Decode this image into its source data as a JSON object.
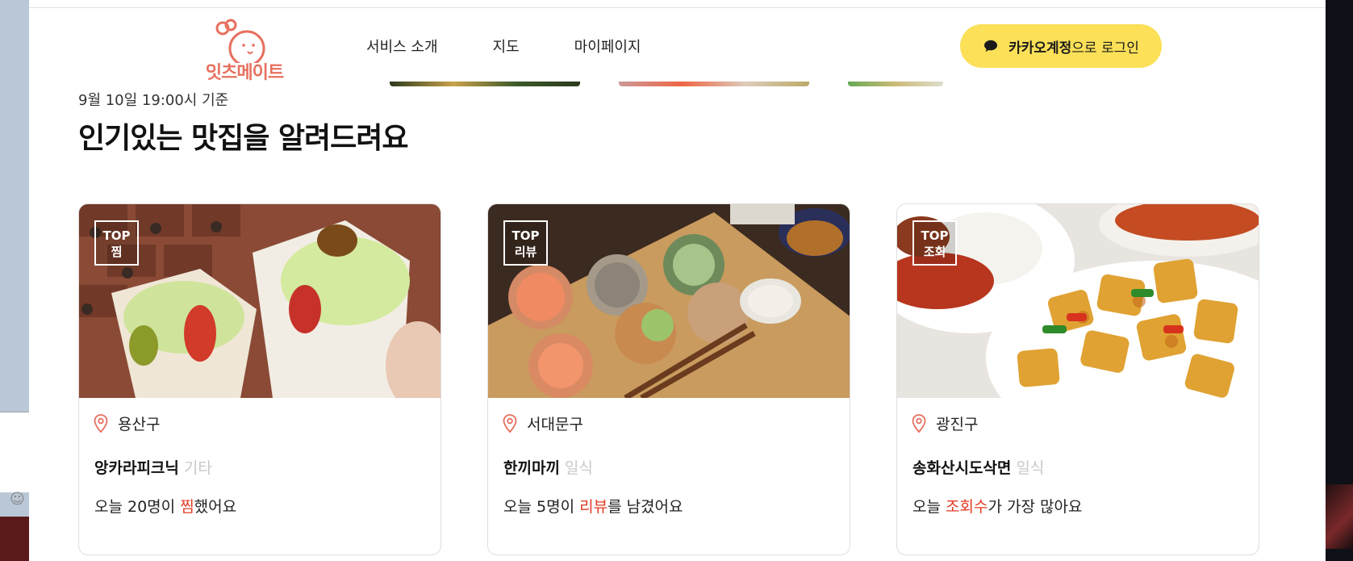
{
  "logo": {
    "text": "잇츠메이트",
    "icon": "chef-face-logo-icon"
  },
  "nav": {
    "items": [
      "서비스 소개",
      "지도",
      "마이페이지"
    ]
  },
  "login": {
    "strong": "카카오계정",
    "rest": "으로 로그인",
    "icon": "kakao-talk-bubble-icon"
  },
  "section": {
    "timestamp": "9월 10일 19:00시 기준",
    "title": "인기있는 맛집을 알려드려요"
  },
  "cards": [
    {
      "badge_top": "TOP",
      "badge_type": "찜",
      "district": "용산구",
      "name": "앙카라피크닉",
      "category": "기타",
      "stat_pre": "오늘 20명이 ",
      "stat_hl": "찜",
      "stat_post": "했어요"
    },
    {
      "badge_top": "TOP",
      "badge_type": "리뷰",
      "district": "서대문구",
      "name": "한끼마끼",
      "category": "일식",
      "stat_pre": "오늘 5명이 ",
      "stat_hl": "리뷰",
      "stat_post": "를 남겼어요"
    },
    {
      "badge_top": "TOP",
      "badge_type": "조회",
      "district": "광진구",
      "name": "송화산시도삭면",
      "category": "일식",
      "stat_pre": "오늘 ",
      "stat_hl": "조회수",
      "stat_post": "가 가장 많아요"
    }
  ],
  "colors": {
    "brand": "#e7705e",
    "kakao": "#fbe058",
    "highlight": "#e23b23",
    "category": "#c8c8c8"
  }
}
